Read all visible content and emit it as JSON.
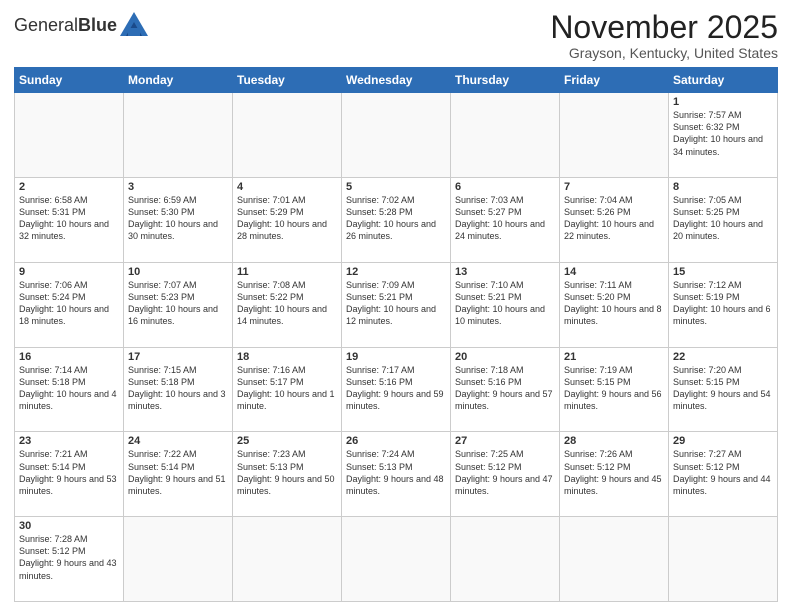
{
  "header": {
    "logo_text_normal": "General",
    "logo_text_bold": "Blue",
    "month_title": "November 2025",
    "location": "Grayson, Kentucky, United States"
  },
  "days_of_week": [
    "Sunday",
    "Monday",
    "Tuesday",
    "Wednesday",
    "Thursday",
    "Friday",
    "Saturday"
  ],
  "weeks": [
    [
      {
        "day": "",
        "info": ""
      },
      {
        "day": "",
        "info": ""
      },
      {
        "day": "",
        "info": ""
      },
      {
        "day": "",
        "info": ""
      },
      {
        "day": "",
        "info": ""
      },
      {
        "day": "",
        "info": ""
      },
      {
        "day": "1",
        "info": "Sunrise: 7:57 AM\nSunset: 6:32 PM\nDaylight: 10 hours and 34 minutes."
      }
    ],
    [
      {
        "day": "2",
        "info": "Sunrise: 6:58 AM\nSunset: 5:31 PM\nDaylight: 10 hours and 32 minutes."
      },
      {
        "day": "3",
        "info": "Sunrise: 6:59 AM\nSunset: 5:30 PM\nDaylight: 10 hours and 30 minutes."
      },
      {
        "day": "4",
        "info": "Sunrise: 7:01 AM\nSunset: 5:29 PM\nDaylight: 10 hours and 28 minutes."
      },
      {
        "day": "5",
        "info": "Sunrise: 7:02 AM\nSunset: 5:28 PM\nDaylight: 10 hours and 26 minutes."
      },
      {
        "day": "6",
        "info": "Sunrise: 7:03 AM\nSunset: 5:27 PM\nDaylight: 10 hours and 24 minutes."
      },
      {
        "day": "7",
        "info": "Sunrise: 7:04 AM\nSunset: 5:26 PM\nDaylight: 10 hours and 22 minutes."
      },
      {
        "day": "8",
        "info": "Sunrise: 7:05 AM\nSunset: 5:25 PM\nDaylight: 10 hours and 20 minutes."
      }
    ],
    [
      {
        "day": "9",
        "info": "Sunrise: 7:06 AM\nSunset: 5:24 PM\nDaylight: 10 hours and 18 minutes."
      },
      {
        "day": "10",
        "info": "Sunrise: 7:07 AM\nSunset: 5:23 PM\nDaylight: 10 hours and 16 minutes."
      },
      {
        "day": "11",
        "info": "Sunrise: 7:08 AM\nSunset: 5:22 PM\nDaylight: 10 hours and 14 minutes."
      },
      {
        "day": "12",
        "info": "Sunrise: 7:09 AM\nSunset: 5:21 PM\nDaylight: 10 hours and 12 minutes."
      },
      {
        "day": "13",
        "info": "Sunrise: 7:10 AM\nSunset: 5:21 PM\nDaylight: 10 hours and 10 minutes."
      },
      {
        "day": "14",
        "info": "Sunrise: 7:11 AM\nSunset: 5:20 PM\nDaylight: 10 hours and 8 minutes."
      },
      {
        "day": "15",
        "info": "Sunrise: 7:12 AM\nSunset: 5:19 PM\nDaylight: 10 hours and 6 minutes."
      }
    ],
    [
      {
        "day": "16",
        "info": "Sunrise: 7:14 AM\nSunset: 5:18 PM\nDaylight: 10 hours and 4 minutes."
      },
      {
        "day": "17",
        "info": "Sunrise: 7:15 AM\nSunset: 5:18 PM\nDaylight: 10 hours and 3 minutes."
      },
      {
        "day": "18",
        "info": "Sunrise: 7:16 AM\nSunset: 5:17 PM\nDaylight: 10 hours and 1 minute."
      },
      {
        "day": "19",
        "info": "Sunrise: 7:17 AM\nSunset: 5:16 PM\nDaylight: 9 hours and 59 minutes."
      },
      {
        "day": "20",
        "info": "Sunrise: 7:18 AM\nSunset: 5:16 PM\nDaylight: 9 hours and 57 minutes."
      },
      {
        "day": "21",
        "info": "Sunrise: 7:19 AM\nSunset: 5:15 PM\nDaylight: 9 hours and 56 minutes."
      },
      {
        "day": "22",
        "info": "Sunrise: 7:20 AM\nSunset: 5:15 PM\nDaylight: 9 hours and 54 minutes."
      }
    ],
    [
      {
        "day": "23",
        "info": "Sunrise: 7:21 AM\nSunset: 5:14 PM\nDaylight: 9 hours and 53 minutes."
      },
      {
        "day": "24",
        "info": "Sunrise: 7:22 AM\nSunset: 5:14 PM\nDaylight: 9 hours and 51 minutes."
      },
      {
        "day": "25",
        "info": "Sunrise: 7:23 AM\nSunset: 5:13 PM\nDaylight: 9 hours and 50 minutes."
      },
      {
        "day": "26",
        "info": "Sunrise: 7:24 AM\nSunset: 5:13 PM\nDaylight: 9 hours and 48 minutes."
      },
      {
        "day": "27",
        "info": "Sunrise: 7:25 AM\nSunset: 5:12 PM\nDaylight: 9 hours and 47 minutes."
      },
      {
        "day": "28",
        "info": "Sunrise: 7:26 AM\nSunset: 5:12 PM\nDaylight: 9 hours and 45 minutes."
      },
      {
        "day": "29",
        "info": "Sunrise: 7:27 AM\nSunset: 5:12 PM\nDaylight: 9 hours and 44 minutes."
      }
    ],
    [
      {
        "day": "30",
        "info": "Sunrise: 7:28 AM\nSunset: 5:12 PM\nDaylight: 9 hours and 43 minutes."
      },
      {
        "day": "",
        "info": ""
      },
      {
        "day": "",
        "info": ""
      },
      {
        "day": "",
        "info": ""
      },
      {
        "day": "",
        "info": ""
      },
      {
        "day": "",
        "info": ""
      },
      {
        "day": "",
        "info": ""
      }
    ]
  ]
}
